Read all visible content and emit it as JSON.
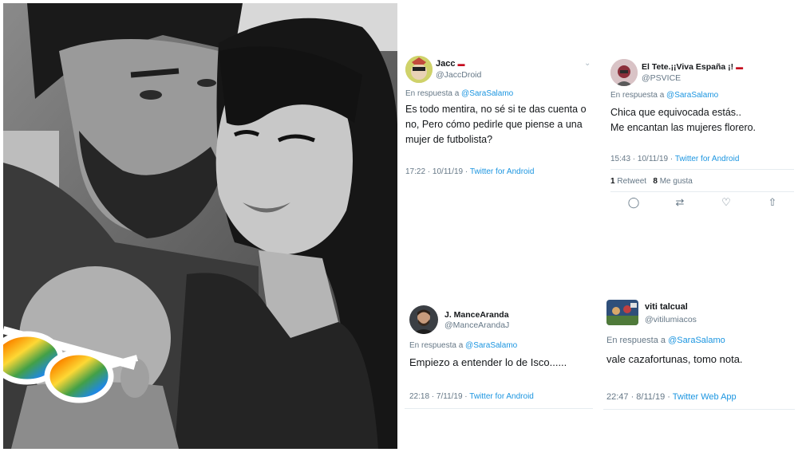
{
  "tweets": [
    {
      "name": "Jacc",
      "handle": "@JaccDroid",
      "reply_prefix": "En respuesta a",
      "reply_to": "@SaraSalamo",
      "text": "Es todo mentira, no sé si te das cuenta o no, Pero cómo pedirle que piense a una mujer de futbolista?",
      "time": "17:22 · 10/11/19 ·",
      "source": "Twitter for Android",
      "has_flag": true
    },
    {
      "name": "El Tete.¡¡Viva España ¡!",
      "handle": "@PSVICE",
      "reply_prefix": "En respuesta a",
      "reply_to": "@SaraSalamo",
      "text": "Chica que equivocada estás..\nMe encantan las mujeres florero.",
      "time": "15:43 · 10/11/19 ·",
      "source": "Twitter for Android",
      "retweets": "1",
      "retweets_label": "Retweet",
      "likes": "8",
      "likes_label": "Me gusta",
      "has_flag": true
    },
    {
      "name": "J. ManceAranda",
      "handle": "@ManceArandaJ",
      "reply_prefix": "En respuesta a",
      "reply_to": "@SaraSalamo",
      "text": "Empiezo a entender lo de Isco......",
      "time": "22:18 · 7/11/19 ·",
      "source": "Twitter for Android"
    },
    {
      "name": "viti talcual",
      "handle": "@vitilumiacos",
      "reply_prefix": "En respuesta a",
      "reply_to": "@SaraSalamo",
      "text": "vale cazafortunas, tomo nota.",
      "time": "22:47 · 8/11/19 ·",
      "source": "Twitter Web App"
    }
  ],
  "icons": {
    "flag": "spain-flag-icon",
    "chevron": "chevron-down-icon",
    "reply": "reply-icon",
    "retweet": "retweet-icon",
    "like": "heart-icon",
    "share": "share-icon"
  },
  "colors": {
    "link": "#1b95e0",
    "muted": "#657786",
    "text": "#14171a"
  }
}
